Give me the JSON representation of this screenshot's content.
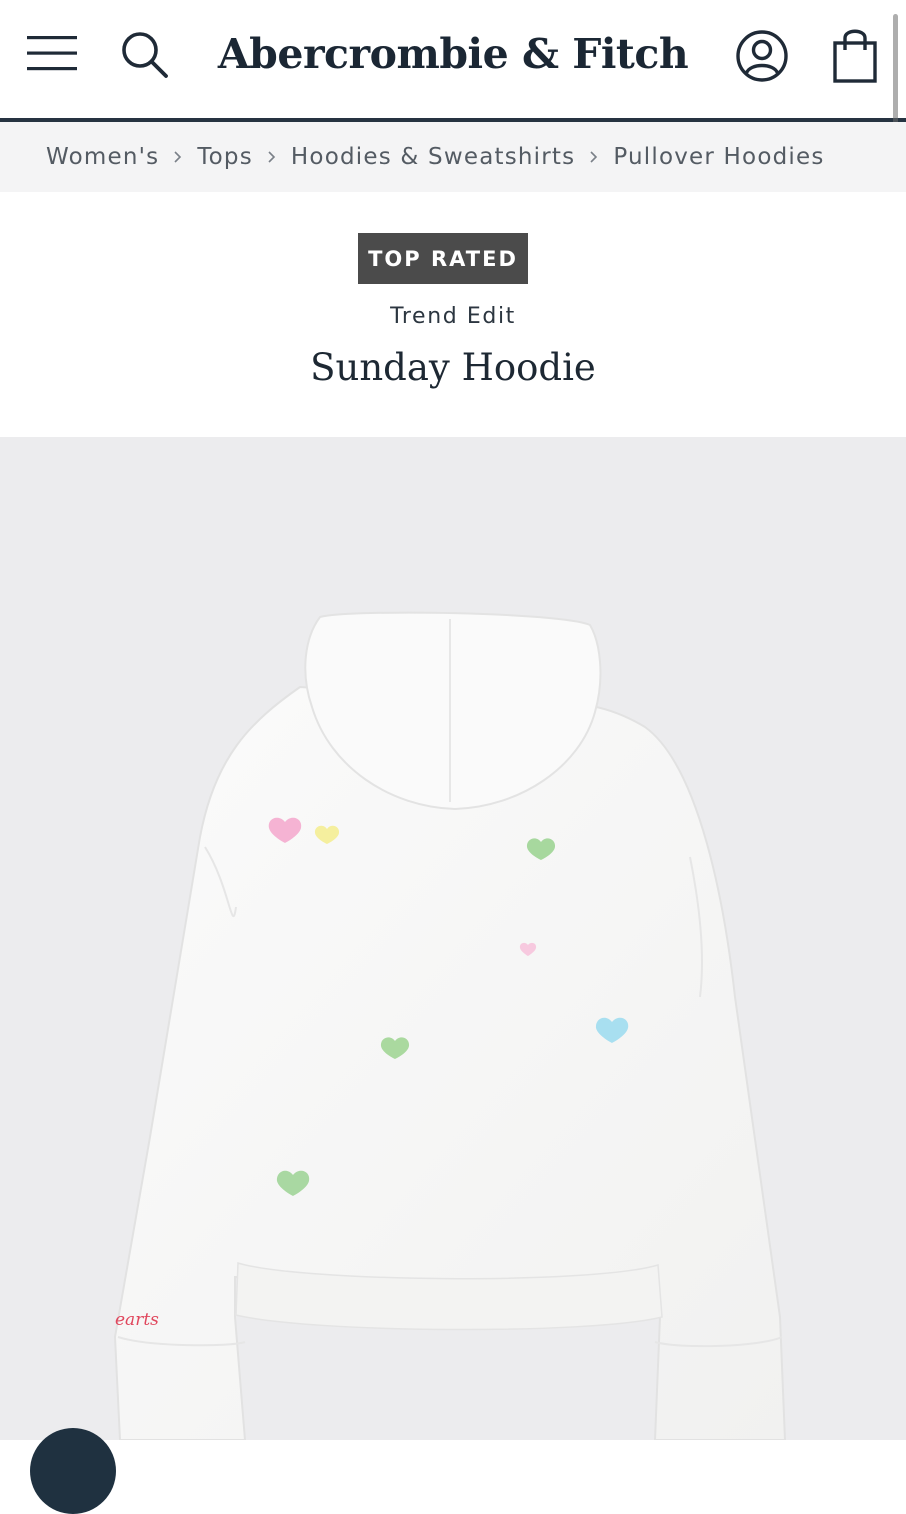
{
  "header": {
    "logo": "Abercrombie & Fitch",
    "icons": [
      "menu-icon",
      "search-icon",
      "account-icon",
      "shopping-bag-icon"
    ]
  },
  "breadcrumb": {
    "items": [
      "Women's",
      "Tops",
      "Hoodies & Sweatshirts",
      "Pullover Hoodies"
    ]
  },
  "product": {
    "badge": "TOP RATED",
    "collection": "Trend Edit",
    "name": "Sunday Hoodie",
    "sleeve_text": "earts"
  },
  "colors": {
    "header_border": "#263341",
    "badge_bg": "#4b4b4b",
    "image_bg": "#ececee",
    "breadcrumb_bg": "#f4f4f5"
  }
}
